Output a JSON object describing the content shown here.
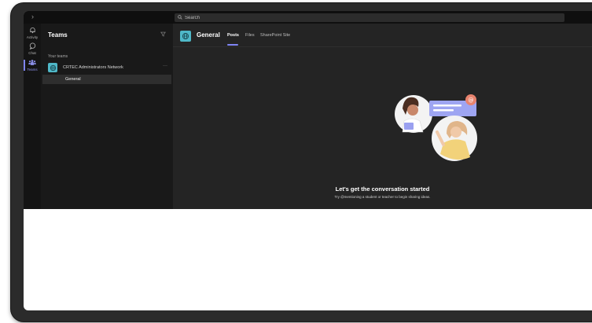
{
  "topbar": {
    "search_placeholder": "Search",
    "back_glyph": "›"
  },
  "rail": {
    "items": [
      {
        "label": "Activity",
        "icon": "bell-icon"
      },
      {
        "label": "Chat",
        "icon": "chat-icon"
      },
      {
        "label": "Teams",
        "icon": "teams-icon",
        "active": true
      }
    ]
  },
  "panel": {
    "title": "Teams",
    "section_label": "Your teams",
    "team": {
      "name": "CRTEC Administrators Network",
      "more": "···"
    },
    "channel": "General"
  },
  "main": {
    "channel_title": "General",
    "tabs": [
      "Posts",
      "Files",
      "SharePoint Site"
    ],
    "active_tab": "Posts",
    "empty_title": "Let's get the conversation started",
    "empty_subtitle": "Try @mentioning a student or teacher to begin sharing ideas."
  },
  "colors": {
    "accent": "#7f85f5",
    "team_avatar": "#4fb8c8",
    "background": "#1f1f1f"
  }
}
